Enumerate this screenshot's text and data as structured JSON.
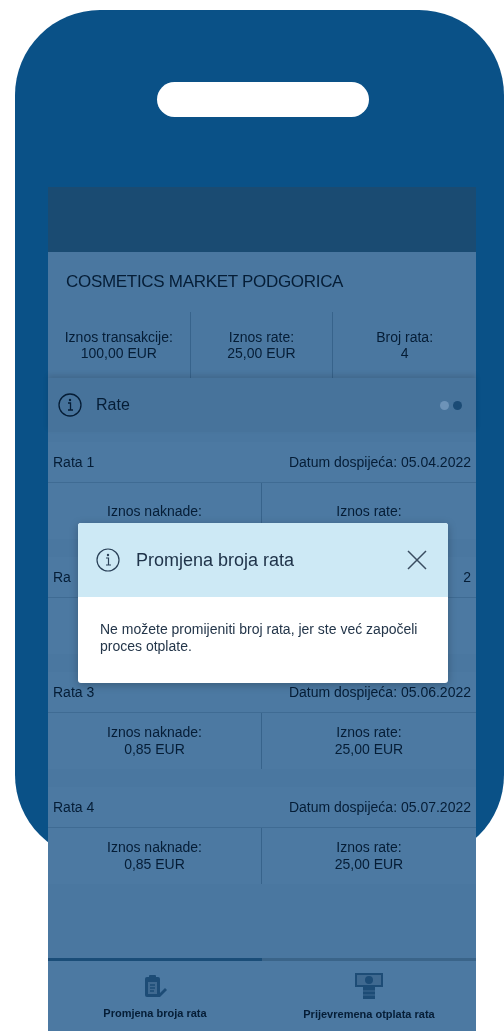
{
  "merchant": "COSMETICS MARKET PODGORICA",
  "summary": [
    {
      "label": "Iznos transakcije:",
      "value": "100,00 EUR"
    },
    {
      "label": "Iznos rate:",
      "value": "25,00 EUR"
    },
    {
      "label": "Broj rata:",
      "value": "4"
    }
  ],
  "section": {
    "title": "Rate",
    "pages": [
      {
        "selected": false
      },
      {
        "selected": true
      }
    ]
  },
  "installments": [
    {
      "title": "Rata 1",
      "due": "Datum dospijeća: 05.04.2022",
      "fee_label": "Iznos naknade:",
      "amount_label": "Iznos rate:"
    },
    {
      "title": "Ra",
      "due": "2"
    },
    {
      "title": "Rata 3",
      "due": "Datum dospijeća: 05.06.2022",
      "fee_label": "Iznos naknade:",
      "fee": "0,85 EUR",
      "amount_label": "Iznos rate:",
      "amount": "25,00 EUR"
    },
    {
      "title": "Rata 4",
      "due": "Datum dospijeća: 05.07.2022",
      "fee_label": "Iznos naknade:",
      "fee": "0,85 EUR",
      "amount_label": "Iznos rate:",
      "amount": "25,00 EUR"
    }
  ],
  "dialog": {
    "title": "Promjena broja rata",
    "message": "Ne možete promijeniti broj rata, jer ste već započeli proces otplate."
  },
  "tabs": [
    {
      "kind": "clipboard",
      "label": "Promjena broja rata",
      "selected": true
    },
    {
      "kind": "cash",
      "label": "Prijevremena otplata rata",
      "selected": false
    }
  ]
}
